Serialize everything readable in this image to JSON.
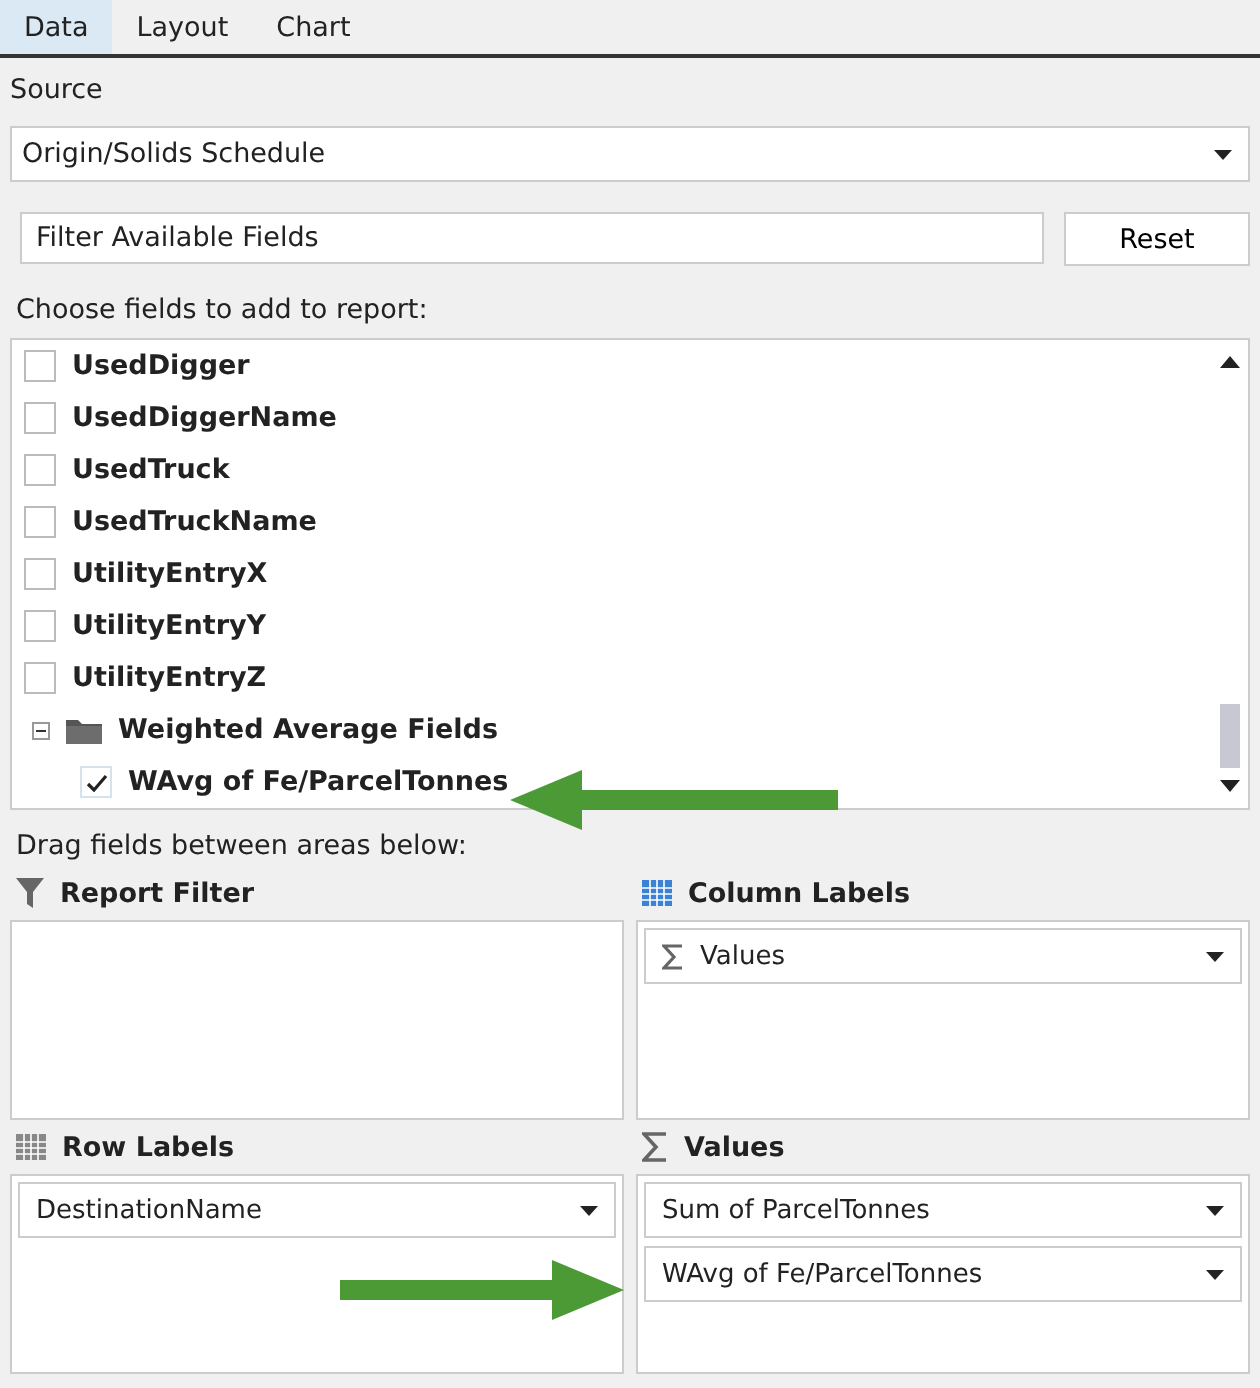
{
  "tabs": [
    {
      "label": "Data",
      "selected": true
    },
    {
      "label": "Layout",
      "selected": false
    },
    {
      "label": "Chart",
      "selected": false
    }
  ],
  "source": {
    "label": "Source",
    "value": "Origin/Solids Schedule"
  },
  "filter": {
    "placeholder": "Filter Available Fields",
    "reset_button": "Reset"
  },
  "fields_label": "Choose fields to add to report:",
  "fields": [
    {
      "kind": "field",
      "label": "UsedDigger",
      "checked": false
    },
    {
      "kind": "field",
      "label": "UsedDiggerName",
      "checked": false
    },
    {
      "kind": "field",
      "label": "UsedTruck",
      "checked": false
    },
    {
      "kind": "field",
      "label": "UsedTruckName",
      "checked": false
    },
    {
      "kind": "field",
      "label": "UtilityEntryX",
      "checked": false
    },
    {
      "kind": "field",
      "label": "UtilityEntryY",
      "checked": false
    },
    {
      "kind": "field",
      "label": "UtilityEntryZ",
      "checked": false
    },
    {
      "kind": "folder",
      "label": "Weighted Average Fields",
      "expanded": true,
      "children": [
        {
          "kind": "field",
          "label": "WAvg of Fe/ParcelTonnes",
          "checked": true
        }
      ]
    }
  ],
  "areas_label": "Drag fields between areas below:",
  "areas": [
    {
      "kind": "filter",
      "title": "Report Filter"
    },
    {
      "kind": "columns",
      "title": "Column Labels",
      "items": [
        {
          "label": "Values",
          "sigma": true
        }
      ]
    },
    {
      "kind": "rows",
      "title": "Row Labels",
      "items": [
        {
          "label": "DestinationName",
          "sigma": false
        }
      ]
    },
    {
      "kind": "values",
      "title": "Values",
      "items": [
        {
          "label": "Sum of ParcelTonnes",
          "sigma": false
        },
        {
          "label": "WAvg of Fe/ParcelTonnes",
          "sigma": false
        }
      ]
    }
  ]
}
